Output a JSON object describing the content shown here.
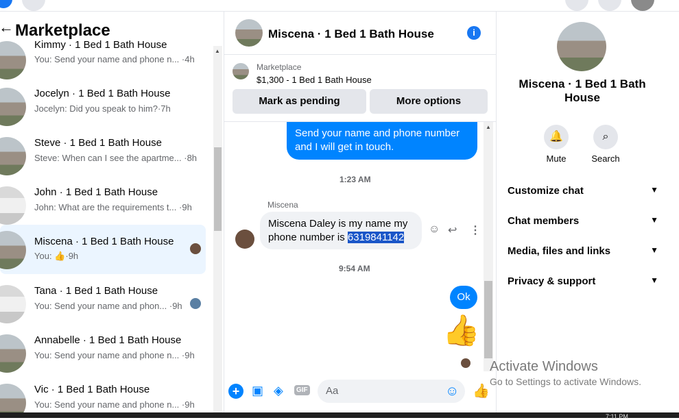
{
  "header": {
    "panel_title": "Marketplace"
  },
  "conversations": [
    {
      "name": "Kimmy · 1 Bed 1 Bath House",
      "snippet": "You: Send your name and phone n...",
      "time": "·4h",
      "thumb": "brown"
    },
    {
      "name": "Jocelyn · 1 Bed 1 Bath House",
      "snippet": "Jocelyn: Did you speak to him?",
      "time": "·7h",
      "thumb": "brown"
    },
    {
      "name": "Steve · 1 Bed 1 Bath House",
      "snippet": "Steve: When can I see the apartme...",
      "time": "·8h",
      "thumb": "brown"
    },
    {
      "name": "John · 1 Bed 1 Bath House",
      "snippet": "John: What are the requirements t...",
      "time": "·9h",
      "thumb": "white"
    },
    {
      "name": "Miscena · 1 Bed 1 Bath House",
      "snippet": "You:",
      "time": "·9h",
      "thumb": "brown",
      "active": true
    },
    {
      "name": "Tana · 1 Bed 1 Bath House",
      "snippet": "You: Send your name and phon...",
      "time": "·9h",
      "thumb": "white"
    },
    {
      "name": "Annabelle · 1 Bed 1 Bath House",
      "snippet": "You: Send your name and phone n...",
      "time": "·9h",
      "thumb": "brown"
    },
    {
      "name": "Vic · 1 Bed 1 Bath House",
      "snippet": "You: Send your name and phone n...",
      "time": "·9h",
      "thumb": "brown"
    }
  ],
  "chat": {
    "title": "Miscena · 1 Bed 1 Bath House",
    "listing_source": "Marketplace",
    "listing_price": "$1,300 - 1 Bed 1 Bath House",
    "mark_pending": "Mark as pending",
    "more_options": "More options",
    "msg_out_1": "Send your name and phone number and I will get in touch.",
    "time_1": "1:23 AM",
    "sender_name": "Miscena",
    "msg_in_1": "Miscena Daley is my name my phone number is",
    "msg_in_1_highlight": "6319841142",
    "time_2": "9:54 AM",
    "msg_out_2": "Ok",
    "composer_placeholder": "Aa"
  },
  "details": {
    "title": "Miscena · 1 Bed 1 Bath House",
    "mute": "Mute",
    "search": "Search",
    "rows": [
      "Customize chat",
      "Chat members",
      "Media, files and links",
      "Privacy & support"
    ]
  },
  "watermark": {
    "line1": "Activate Windows",
    "line2": "Go to Settings to activate Windows."
  },
  "taskbar": {
    "clock": "7:11 PM"
  },
  "colors": {
    "accent": "#0084ff",
    "active_row": "#ebf5ff"
  }
}
